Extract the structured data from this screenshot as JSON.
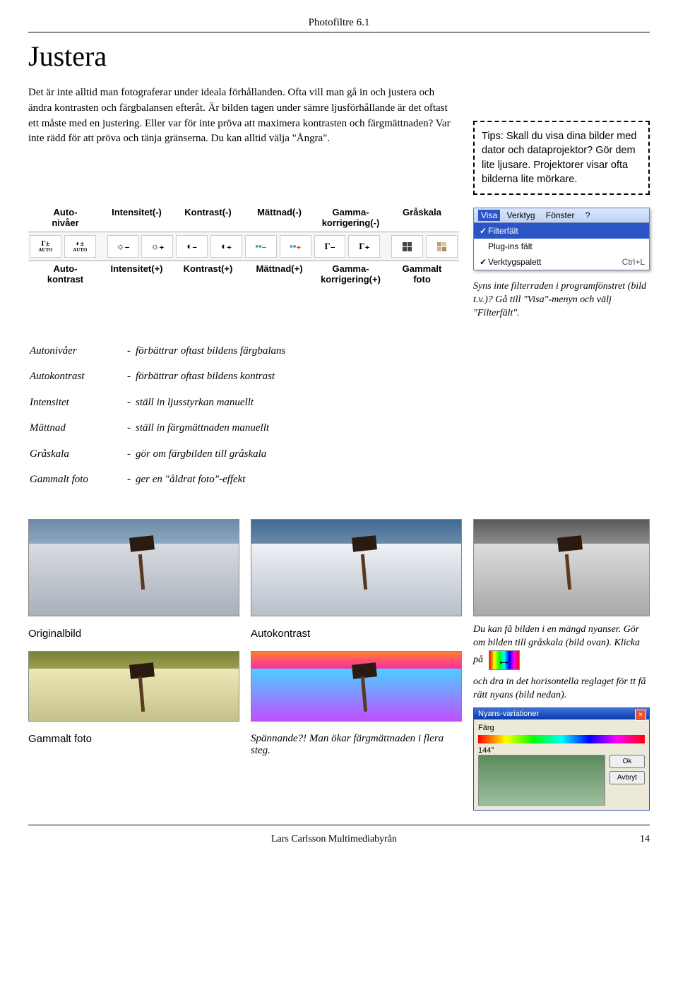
{
  "header": "Photofiltre 6.1",
  "title": "Justera",
  "intro": "Det är inte alltid man fotograferar under ideala förhållanden. Ofta vill man gå in och justera och ändra kontrasten och färgbalansen efteråt. Är bilden tagen under sämre ljusförhållande är det oftast ett måste med en justering. Eller var för inte pröva att maximera kontrasten och färgmättnaden? Var inte rädd för att pröva och tänja gränserna. Du kan alltid välja \"Ångra\".",
  "tips": "Tips: Skall du visa dina bilder med dator och dataprojektor? Gör dem lite ljusare. Projektorer visar ofta bilderna lite mörkare.",
  "toolbar": {
    "topLabels": [
      "Auto-\nnivåer",
      "Intensitet(-)",
      "Kontrast(-)",
      "Mättnad(-)",
      "Gamma-\nkorrigering(-)",
      "Gråskala"
    ],
    "bottomLabels": [
      "Auto-\nkontrast",
      "Intensitet(+)",
      "Kontrast(+)",
      "Mättnad(+)",
      "Gamma-\nkorrigering(+)",
      "Gammalt\nfoto"
    ],
    "icons": {
      "auto_levels": "Γ±",
      "auto_levels_sub": "AUTO",
      "auto_contrast": "◐±",
      "auto_contrast_sub": "AUTO",
      "intensity_minus": "☼₋",
      "intensity_plus": "☼₊",
      "contrast_minus": "◐₋",
      "contrast_plus": "◐₊",
      "saturation_minus": "▪₋",
      "saturation_plus": "▪₊",
      "gamma_minus": "Γ₋",
      "gamma_plus": "Γ₊",
      "grayscale": "▦",
      "oldphoto": "▤"
    }
  },
  "menu": {
    "topRow": [
      "Visa",
      "Verktyg",
      "Fönster",
      "?"
    ],
    "items": [
      {
        "label": "Filterfält",
        "checked": true,
        "selected": true,
        "shortcut": ""
      },
      {
        "label": "Plug-ins fält",
        "checked": false,
        "selected": false,
        "shortcut": ""
      },
      {
        "label": "Verktygspalett",
        "checked": true,
        "selected": false,
        "shortcut": "Ctrl+L"
      }
    ]
  },
  "filterradNote": "Syns inte filterraden i programfönstret (bild t.v.)? Gå till \"Visa\"-menyn och välj \"Filterfält\".",
  "defs": [
    {
      "term": "Autonivåer",
      "desc": "förbättrar oftast bildens färgbalans"
    },
    {
      "term": "Autokontrast",
      "desc": "förbättrar oftast bildens kontrast"
    },
    {
      "term": "Intensitet",
      "desc": "ställ in ljusstyrkan manuellt"
    },
    {
      "term": "Mättnad",
      "desc": "ställ in färgmättnaden manuellt"
    },
    {
      "term": "Gråskala",
      "desc": "gör om färgbilden till gråskala"
    },
    {
      "term": "Gammalt foto",
      "desc": "ger en \"åldrat foto\"-effekt"
    }
  ],
  "captions": {
    "original": "Originalbild",
    "autokontrast": "Autokontrast",
    "gammalt": "Gammalt foto",
    "spannande": "Spännande?! Man ökar färgmättnaden i flera steg."
  },
  "nyansText1": "Du kan få bilden i en mängd nyanser. Gör om bilden till gråskala (bild ovan). Klicka på",
  "nyansText2": "och dra in det horisontella reglaget för tt få rätt nyans (bild nedan).",
  "nyansDialog": {
    "title": "Nyans-variationer",
    "farg": "Färg",
    "value": "144°",
    "ok": "Ok",
    "avbryt": "Avbryt"
  },
  "footer": {
    "author": "Lars Carlsson Multimediabyrån",
    "page": "14"
  }
}
